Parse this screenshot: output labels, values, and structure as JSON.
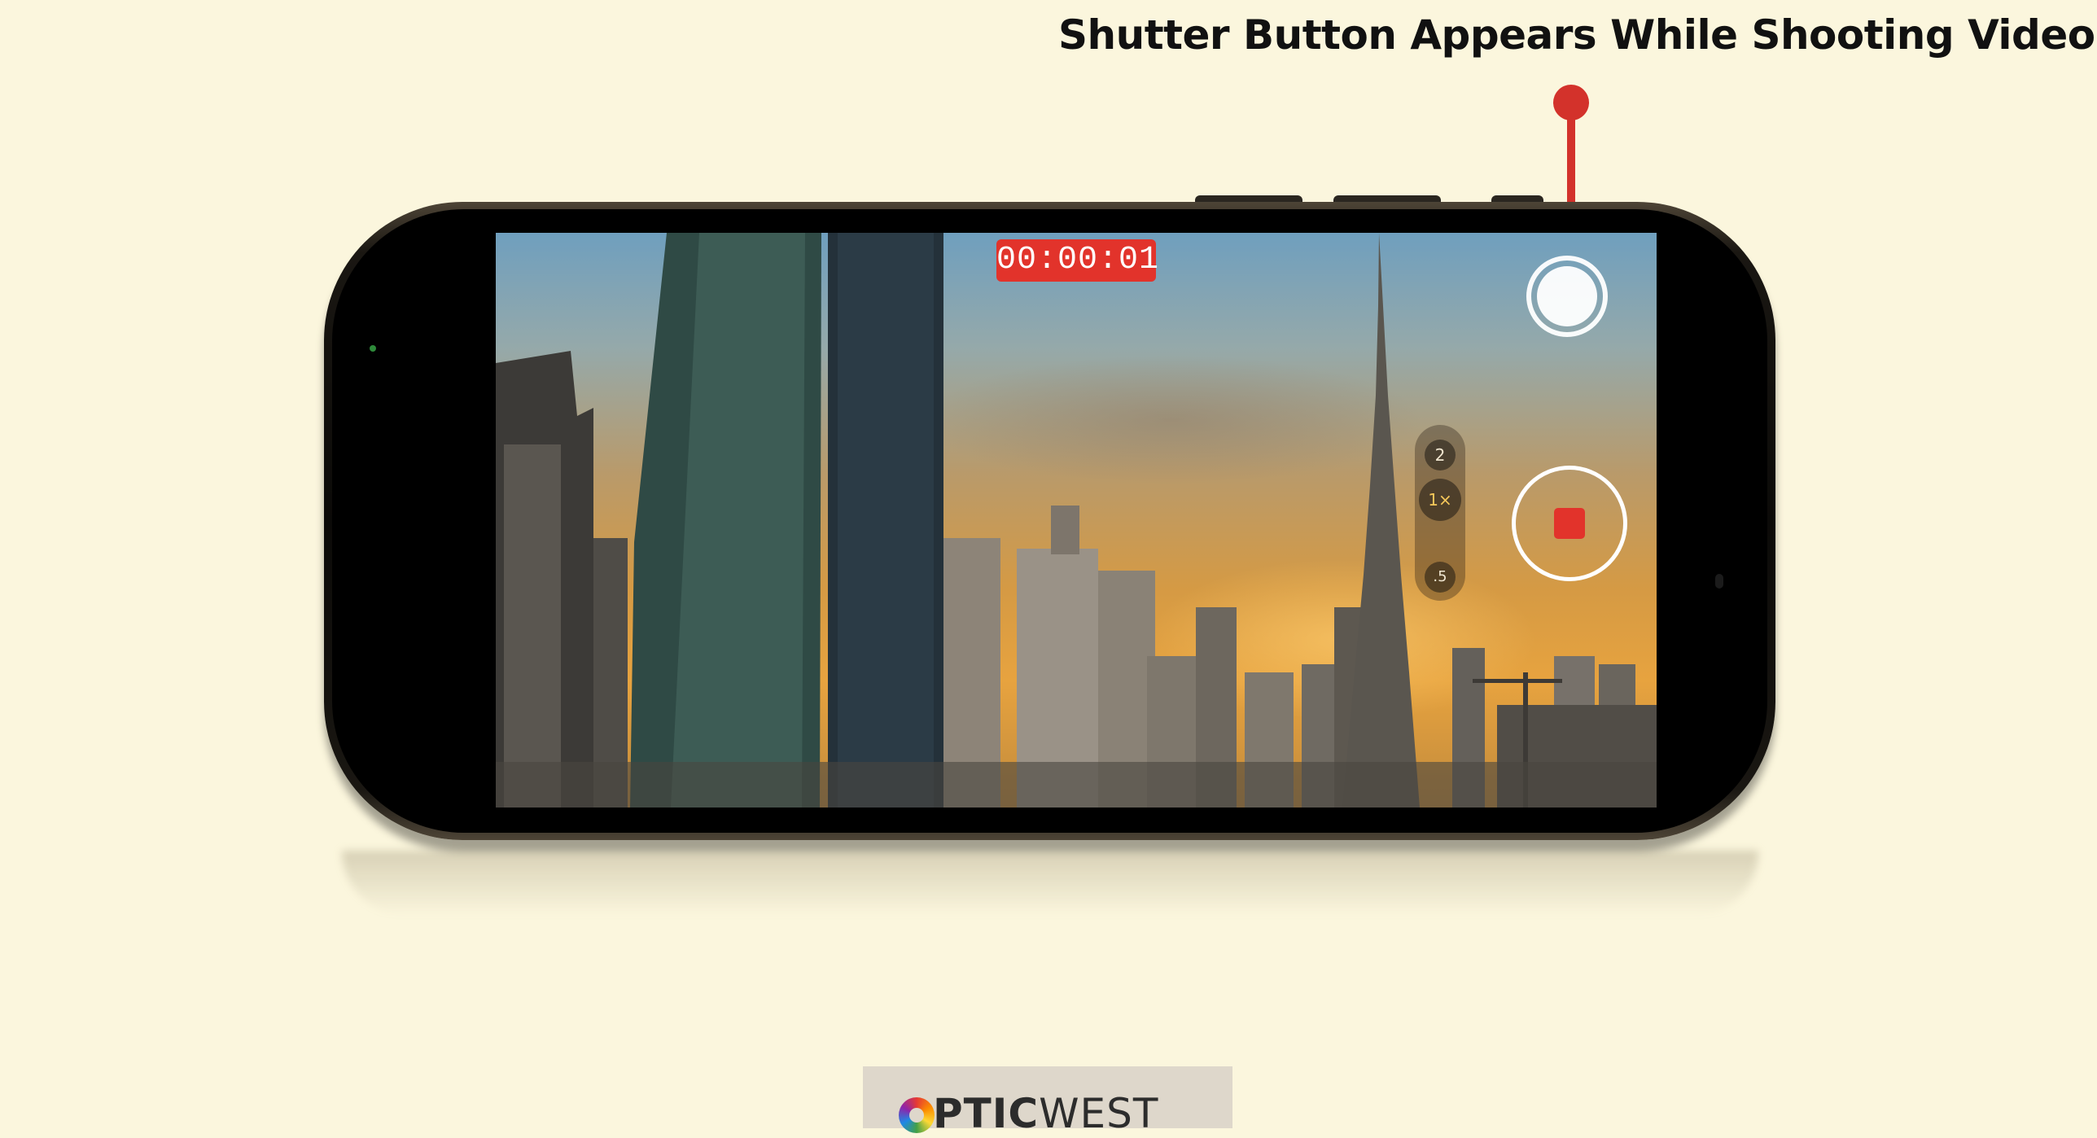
{
  "caption": "Shutter Button Appears While Shooting Video",
  "camera": {
    "timer": "00:00:01",
    "zoom_levels": [
      "2",
      "1×",
      ".5"
    ]
  },
  "logo": {
    "text_bold": "PTIC",
    "text_light": "WEST"
  },
  "colors": {
    "background": "#fbf6dd",
    "accent_red": "#e2332b",
    "annotation_red": "#d3322b"
  }
}
